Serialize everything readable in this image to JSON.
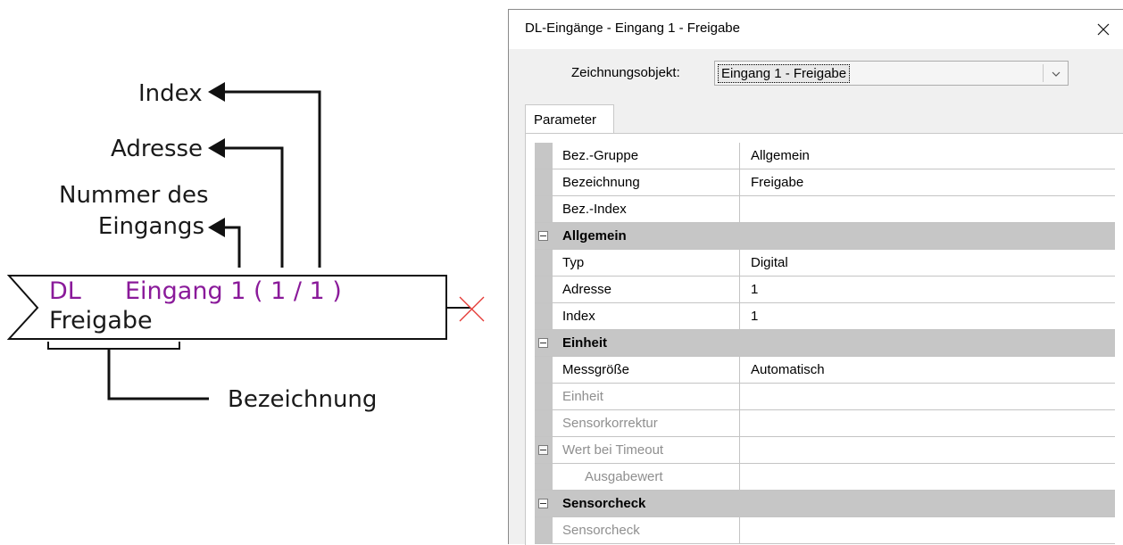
{
  "diagram": {
    "callouts": {
      "index": "Index",
      "adresse": "Adresse",
      "nummer_line1": "Nummer des",
      "nummer_line2": "Eingangs",
      "bezeichnung": "Bezeichnung"
    },
    "block": {
      "source": "DL",
      "input": "Eingang 1 ( 1 / 1 )",
      "name": "Freigabe",
      "accent_color": "#8a1a9a"
    }
  },
  "dialog": {
    "title": "DL-Eingänge - Eingang 1 - Freigabe",
    "close_icon": "close-icon",
    "object_label": "Zeichnungsobjekt:",
    "object_value": "Eingang 1 - Freigabe",
    "tab": "Parameter",
    "grid": {
      "top_rows": [
        {
          "name": "Bez.-Gruppe",
          "value": "Allgemein"
        },
        {
          "name": "Bezeichnung",
          "value": "Freigabe"
        },
        {
          "name": "Bez.-Index",
          "value": ""
        }
      ],
      "allgemein": {
        "label": "Allgemein",
        "rows": [
          {
            "name": "Typ",
            "value": "Digital"
          },
          {
            "name": "Adresse",
            "value": "1"
          },
          {
            "name": "Index",
            "value": "1"
          }
        ]
      },
      "einheit": {
        "label": "Einheit",
        "rows": [
          {
            "name": "Messgröße",
            "value": "Automatisch"
          },
          {
            "name": "Einheit",
            "value": ""
          },
          {
            "name": "Sensorkorrektur",
            "value": ""
          }
        ],
        "timeout_label": "Wert bei Timeout",
        "timeout_sub": "Ausgabewert"
      },
      "sensorcheck": {
        "label": "Sensorcheck",
        "rows": [
          {
            "name": "Sensorcheck",
            "value": ""
          }
        ]
      }
    }
  }
}
